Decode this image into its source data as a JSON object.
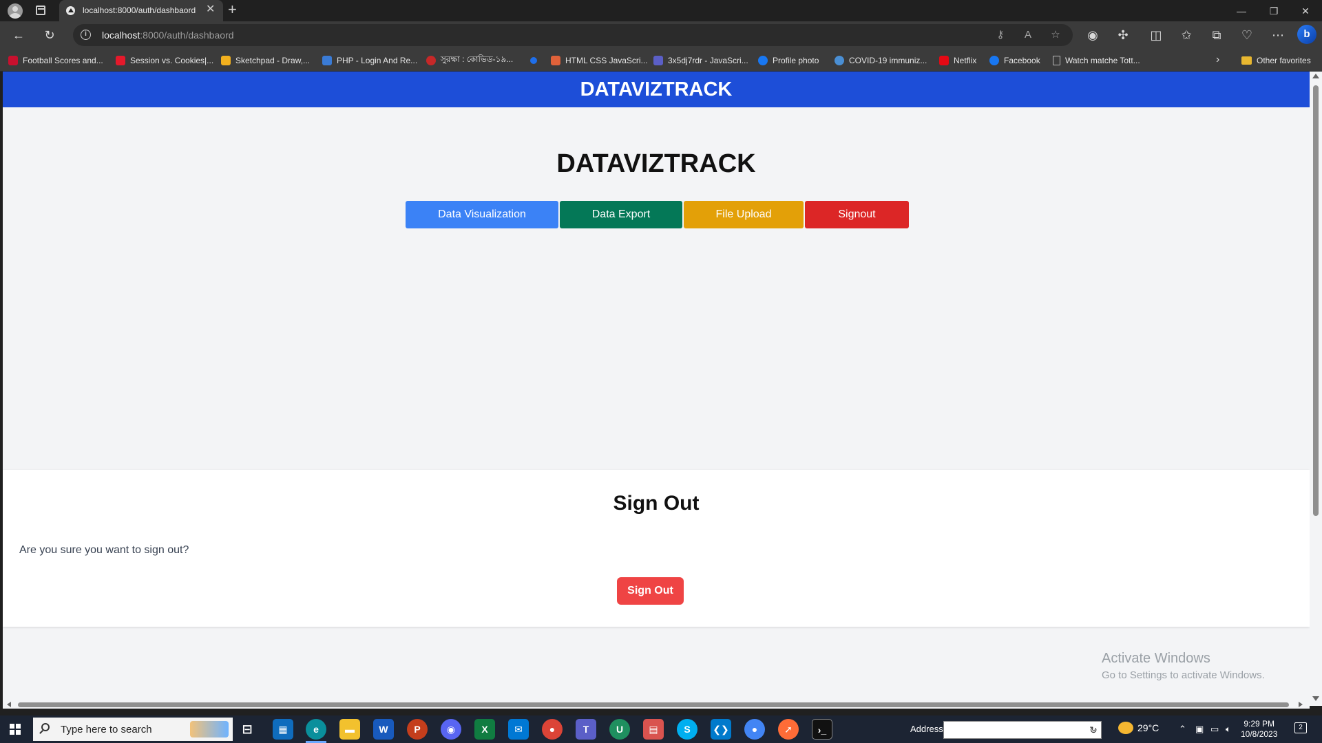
{
  "browser": {
    "tab_title": "localhost:8000/auth/dashbaord",
    "tab_close": "✕",
    "new_tab": "+",
    "url_host": "localhost",
    "url_path": ":8000/auth/dashbaord",
    "window_controls": {
      "minimize": "—",
      "restore": "❐",
      "close": "✕"
    },
    "favorites": [
      {
        "label": "Football Scores and...",
        "color": "#c8102e"
      },
      {
        "label": "Session vs. Cookies|...",
        "color": "#e5192b"
      },
      {
        "label": "Sketchpad - Draw,...",
        "color": "#f2b01e"
      },
      {
        "label": "PHP - Login And Re...",
        "color": "#3a7bd5"
      },
      {
        "label": "সুরক্ষা : কোভিড-১৯...",
        "color": "#c62828"
      },
      {
        "label": "",
        "color": "#1f6feb"
      },
      {
        "label": "HTML CSS JavaScri...",
        "color": "#e0623a"
      },
      {
        "label": "3x5dj7rdr - JavaScri...",
        "color": "#5b5fc7"
      },
      {
        "label": "Profile photo",
        "color": "#1877f2"
      },
      {
        "label": "COVID-19 immuniz...",
        "color": "#4a8fd4"
      },
      {
        "label": "Netflix",
        "color": "#e50914"
      },
      {
        "label": "Facebook",
        "color": "#1877f2"
      },
      {
        "label": "Watch matche Tott...",
        "color": "#bdbdbd"
      }
    ],
    "other_favorites": "Other favorites"
  },
  "page": {
    "header_brand": "DATAVIZTRACK",
    "hero_title": "DATAVIZTRACK",
    "buttons": {
      "visualization": "Data Visualization",
      "export": "Data Export",
      "upload": "File Upload",
      "signout": "Signout"
    },
    "signout_panel": {
      "title": "Sign Out",
      "message": "Are you sure you want to sign out?",
      "confirm": "Sign Out"
    },
    "colors": {
      "header": "#1d4ed8",
      "visualization": "#3b82f6",
      "export": "#047857",
      "upload": "#e3a008",
      "signout": "#dc2626",
      "confirm": "#ef4444"
    }
  },
  "watermark": {
    "line1": "Activate Windows",
    "line2": "Go to Settings to activate Windows."
  },
  "taskbar": {
    "search_placeholder": "Type here to search",
    "address_label": "Address",
    "temperature": "29°C",
    "time": "9:29 PM",
    "date": "10/8/2023",
    "notifications_count": "2"
  }
}
